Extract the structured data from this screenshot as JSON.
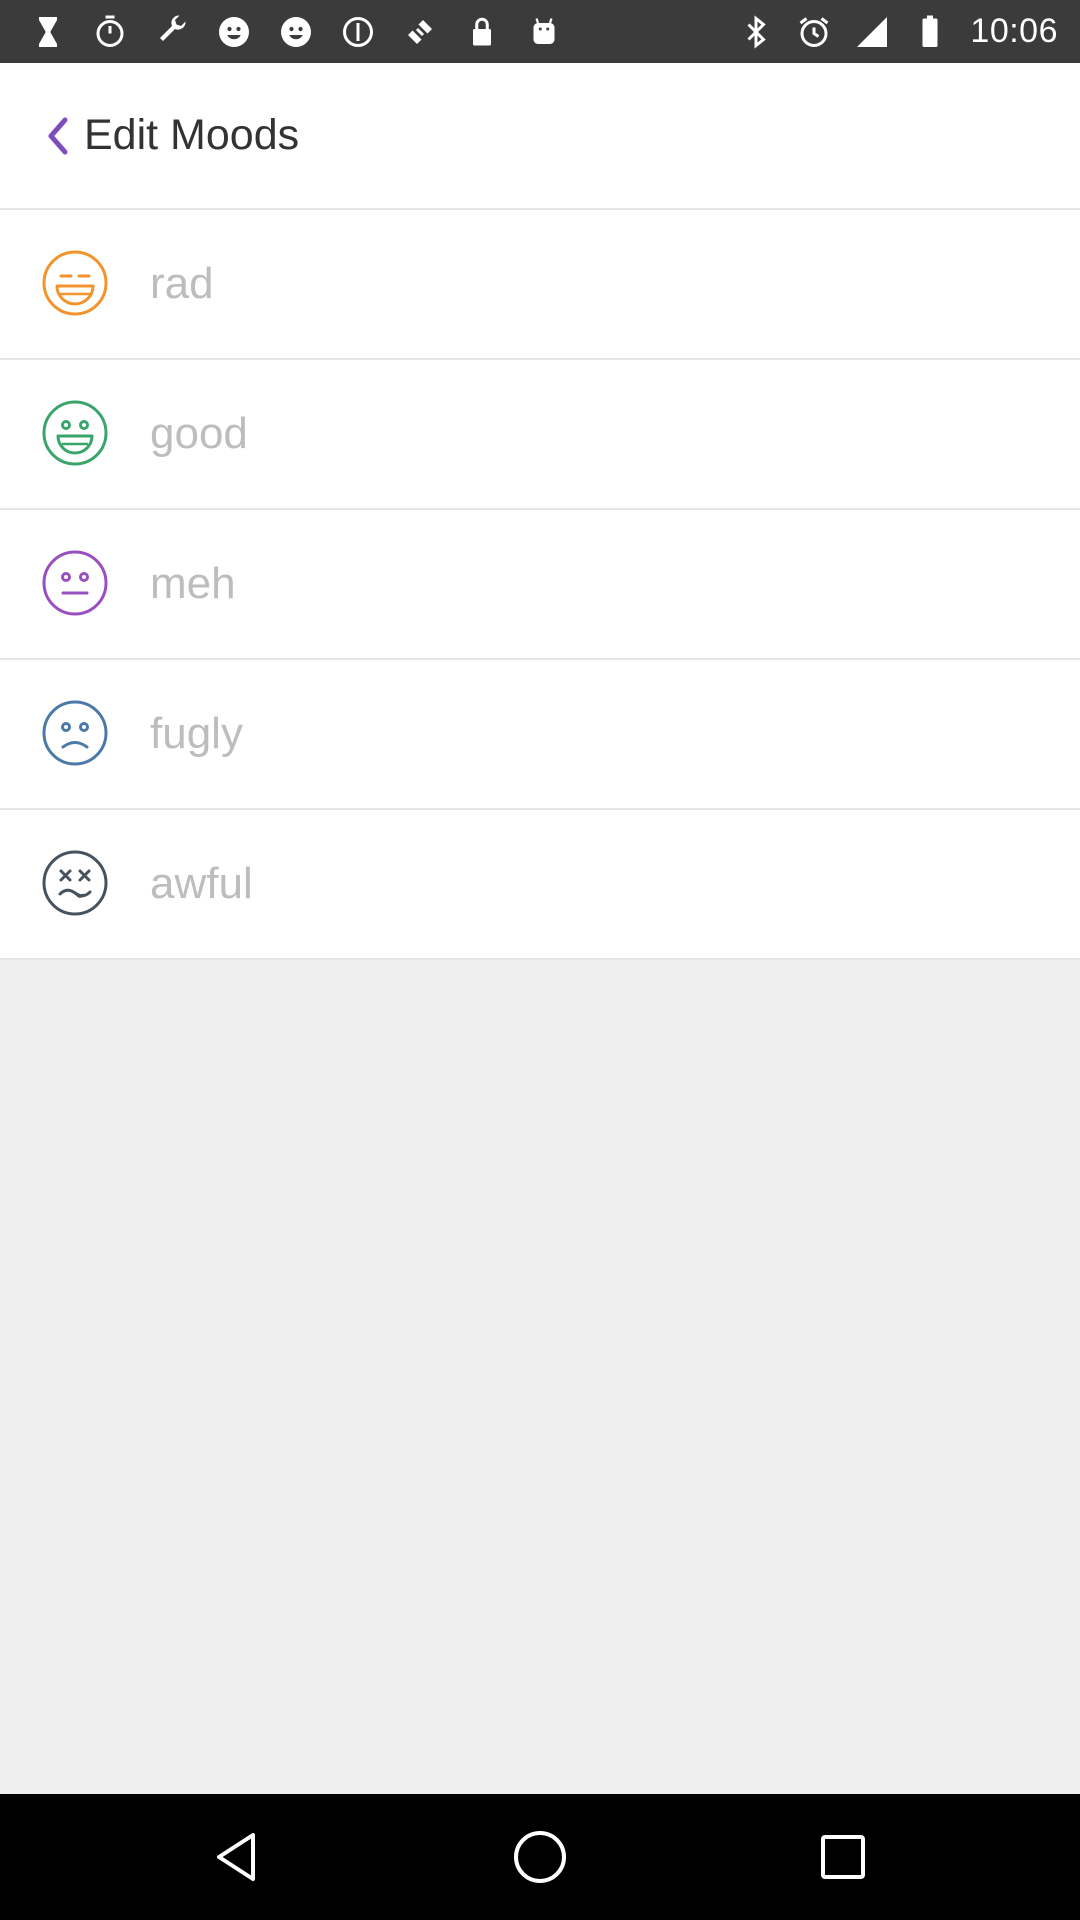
{
  "status_bar": {
    "time": "10:06",
    "left_icons": [
      "hourglass-icon",
      "timer-icon",
      "wrench-icon",
      "smiley-icon",
      "smiley-icon",
      "info-icon",
      "fake-gps-icon",
      "lock-icon",
      "android-icon"
    ],
    "right_icons": [
      "bluetooth-icon",
      "alarm-icon",
      "signal-icon",
      "battery-icon"
    ]
  },
  "header": {
    "title": "Edit Moods",
    "back_color": "#7c4dbe"
  },
  "moods": [
    {
      "label": "rad",
      "color": "#f2932c",
      "icon": "rad-face-icon"
    },
    {
      "label": "good",
      "color": "#3aa56b",
      "icon": "good-face-icon"
    },
    {
      "label": "meh",
      "color": "#9a4fc0",
      "icon": "meh-face-icon"
    },
    {
      "label": "fugly",
      "color": "#4c79a8",
      "icon": "fugly-face-icon"
    },
    {
      "label": "awful",
      "color": "#46525e",
      "icon": "awful-face-icon"
    }
  ],
  "nav": [
    "back-icon",
    "home-icon",
    "recents-icon"
  ]
}
